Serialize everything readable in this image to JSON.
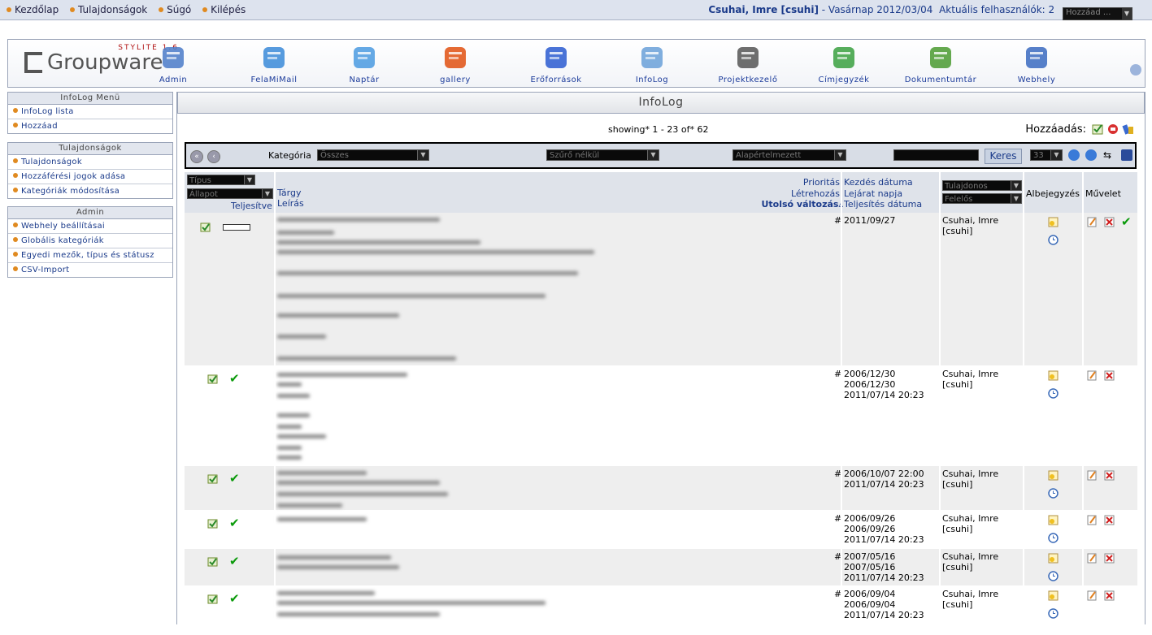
{
  "topbar": {
    "links": [
      "Kezdőlap",
      "Tulajdonságok",
      "Súgó",
      "Kilépés"
    ],
    "user": "Csuhai, Imre [csuhi]",
    "date_text": "- Vasárnap 2012/03/04",
    "active_users": "Aktuális felhasználók: 2",
    "add_select": "Hozzáad ..."
  },
  "logo": {
    "stylite": "STYLITE 1.6",
    "name": "Groupware"
  },
  "apps": [
    {
      "label": "Admin",
      "icon": "admin-icon"
    },
    {
      "label": "FelaMiMail",
      "icon": "mail-icon"
    },
    {
      "label": "Naptár",
      "icon": "calendar-icon"
    },
    {
      "label": "gallery",
      "icon": "gallery-icon"
    },
    {
      "label": "Erőforrások",
      "icon": "resources-icon"
    },
    {
      "label": "InfoLog",
      "icon": "infolog-icon"
    },
    {
      "label": "Projektkezelő",
      "icon": "project-icon"
    },
    {
      "label": "Címjegyzék",
      "icon": "addressbook-icon"
    },
    {
      "label": "Dokumentumtár",
      "icon": "filemanager-icon"
    },
    {
      "label": "Webhely",
      "icon": "website-icon"
    }
  ],
  "sidebar": {
    "infolog": {
      "title": "InfoLog Menü",
      "items": [
        "InfoLog lista",
        "Hozzáad"
      ]
    },
    "prefs": {
      "title": "Tulajdonságok",
      "items": [
        "Tulajdonságok",
        "Hozzáférési jogok adása",
        "Kategóriák módosítása"
      ]
    },
    "admin": {
      "title": "Admin",
      "items": [
        "Webhely beállításai",
        "Globális kategóriák",
        "Egyedi mezők, típus és státusz",
        "CSV-Import"
      ]
    }
  },
  "main": {
    "title": "InfoLog",
    "showing": "showing* 1 - 23 of* 62",
    "add_label": "Hozzáadás:"
  },
  "filter": {
    "category_label": "Kategória",
    "category_value": "Összes",
    "filter_value": "Szűrő nélkül",
    "default_value": "Alapértelmezett",
    "search_button": "Keres",
    "page_size": "33"
  },
  "columns": {
    "type_select": "Típus",
    "status_select": "Állapot",
    "completed": "Teljesítve",
    "subject": "Tárgy",
    "description": "Leírás",
    "priority": "Prioritás",
    "created_by": "Létrehozás",
    "last_modified": "Utolsó változás",
    "start_date": "Kezdés dátuma",
    "due_date": "Lejárat napja",
    "done_date": "Teljesítés dátuma",
    "owner_select": "Tulajdonos",
    "responsible_select": "Felelős",
    "notes": "Albejegyzés",
    "actions": "Művelet"
  },
  "rows": [
    {
      "hash": "#",
      "dates": "2011/09/27",
      "owner": "Csuhai, Imre",
      "login": "[csuhi]"
    },
    {
      "hash": "#",
      "dates": "2006/12/30\n2006/12/30\n2011/07/14 20:23",
      "owner": "Csuhai, Imre",
      "login": "[csuhi]"
    },
    {
      "hash": "#",
      "dates": "2006/10/07 22:00\n2011/07/14 20:23",
      "owner": "Csuhai, Imre",
      "login": "[csuhi]"
    },
    {
      "hash": "#",
      "dates": "2006/09/26\n2006/09/26\n2011/07/14 20:23",
      "owner": "Csuhai, Imre",
      "login": "[csuhi]"
    },
    {
      "hash": "#",
      "dates": "2007/05/16\n2007/05/16\n2011/07/14 20:23",
      "owner": "Csuhai, Imre",
      "login": "[csuhi]"
    },
    {
      "hash": "#",
      "dates": "2006/09/04\n2006/09/04\n2011/07/14 20:23",
      "owner": "Csuhai, Imre",
      "login": "[csuhi]"
    }
  ]
}
